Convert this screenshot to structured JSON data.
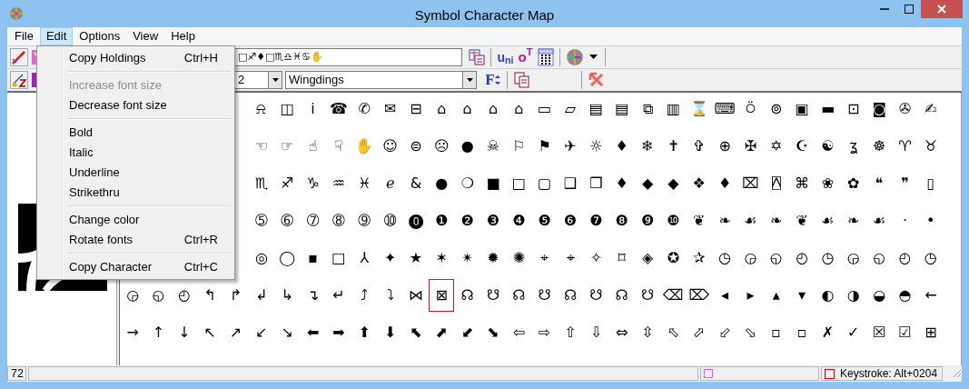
{
  "window": {
    "title": "Symbol Character Map"
  },
  "menu_bar": [
    {
      "label": "File",
      "selected": false
    },
    {
      "label": "Edit",
      "selected": true
    },
    {
      "label": "Options",
      "selected": false
    },
    {
      "label": "View",
      "selected": false
    },
    {
      "label": "Help",
      "selected": false
    }
  ],
  "edit_menu": [
    {
      "kind": "item",
      "label": "Copy Holdings",
      "shortcut": "Ctrl+H",
      "disabled": false
    },
    {
      "kind": "separator"
    },
    {
      "kind": "item",
      "label": "Increase font size",
      "disabled": true
    },
    {
      "kind": "item",
      "label": "Decrease font size",
      "disabled": false
    },
    {
      "kind": "separator"
    },
    {
      "kind": "item",
      "label": "Bold",
      "disabled": false
    },
    {
      "kind": "item",
      "label": "Italic",
      "disabled": false
    },
    {
      "kind": "item",
      "label": "Underline",
      "disabled": false
    },
    {
      "kind": "item",
      "label": "Strikethru",
      "disabled": false
    },
    {
      "kind": "separator"
    },
    {
      "kind": "item",
      "label": "Change color",
      "disabled": false
    },
    {
      "kind": "item",
      "label": "Rotate fonts",
      "shortcut": "Ctrl+R",
      "disabled": false
    },
    {
      "kind": "separator"
    },
    {
      "kind": "item",
      "label": "Copy Character",
      "shortcut": "Ctrl+C",
      "disabled": false
    }
  ],
  "toolbar": {
    "sample_field": {
      "value": "□♐♦□♏♎♓♋✋"
    },
    "uni_button": "u$_{ni}$",
    "opentype_button": "o$^{T}$",
    "size_field": {
      "value": "2"
    },
    "font_field": {
      "value": "Wingdings"
    },
    "font_size_button": "F"
  },
  "grid": {
    "rows": [
      [
        {
          "glyph": "⍾",
          "selected": false
        },
        {
          "glyph": "◫",
          "selected": false
        },
        {
          "glyph": "ⅰ",
          "selected": false
        },
        {
          "glyph": "☎",
          "selected": false
        },
        {
          "glyph": "✆",
          "selected": false
        },
        {
          "glyph": "✉",
          "selected": false
        },
        {
          "glyph": "⊟",
          "selected": false
        },
        {
          "glyph": "⌂",
          "selected": false
        },
        {
          "glyph": "⌂",
          "selected": false
        },
        {
          "glyph": "⌂",
          "selected": false
        },
        {
          "glyph": "⌂",
          "selected": false
        },
        {
          "glyph": "▭",
          "selected": false
        },
        {
          "glyph": "▱",
          "selected": false
        },
        {
          "glyph": "▤",
          "selected": false
        },
        {
          "glyph": "▤",
          "selected": false
        },
        {
          "glyph": "⧉",
          "selected": false
        },
        {
          "glyph": "▥",
          "selected": false
        },
        {
          "glyph": "⌛",
          "selected": false
        },
        {
          "glyph": "⌨",
          "selected": false
        },
        {
          "glyph": "⍥",
          "selected": false
        },
        {
          "glyph": "⊚",
          "selected": false
        },
        {
          "glyph": "▣",
          "selected": false
        },
        {
          "glyph": "▬",
          "selected": false
        },
        {
          "glyph": "⊡",
          "selected": false
        },
        {
          "glyph": "◙",
          "selected": false
        },
        {
          "glyph": "✇",
          "selected": false
        },
        {
          "glyph": "✍",
          "selected": false
        }
      ],
      [
        {
          "glyph": "☜",
          "selected": false
        },
        {
          "glyph": "☞",
          "selected": false
        },
        {
          "glyph": "☝",
          "selected": false
        },
        {
          "glyph": "☟",
          "selected": false
        },
        {
          "glyph": "✋",
          "selected": false
        },
        {
          "glyph": "☺",
          "selected": false
        },
        {
          "glyph": "⊜",
          "selected": false
        },
        {
          "glyph": "☹",
          "selected": false
        },
        {
          "glyph": "●",
          "selected": false
        },
        {
          "glyph": "☠",
          "selected": false
        },
        {
          "glyph": "⚐",
          "selected": false
        },
        {
          "glyph": "⚑",
          "selected": false
        },
        {
          "glyph": "✈",
          "selected": false
        },
        {
          "glyph": "☼",
          "selected": false
        },
        {
          "glyph": "♦",
          "selected": false
        },
        {
          "glyph": "❄",
          "selected": false
        },
        {
          "glyph": "✝",
          "selected": false
        },
        {
          "glyph": "✞",
          "selected": false
        },
        {
          "glyph": "⊕",
          "selected": false
        },
        {
          "glyph": "✠",
          "selected": false
        },
        {
          "glyph": "✡",
          "selected": false
        },
        {
          "glyph": "☪",
          "selected": false
        },
        {
          "glyph": "☯",
          "selected": false
        },
        {
          "glyph": "ʓ",
          "selected": false
        },
        {
          "glyph": "☸",
          "selected": false
        },
        {
          "glyph": "♈",
          "selected": false
        },
        {
          "glyph": "♉",
          "selected": false
        }
      ],
      [
        {
          "glyph": "♏",
          "selected": false
        },
        {
          "glyph": "♐",
          "selected": false
        },
        {
          "glyph": "♑",
          "selected": false
        },
        {
          "glyph": "♒",
          "selected": false
        },
        {
          "glyph": "♓",
          "selected": false
        },
        {
          "glyph": "ℯ",
          "selected": false
        },
        {
          "glyph": "&",
          "selected": false
        },
        {
          "glyph": "●",
          "selected": false
        },
        {
          "glyph": "❍",
          "selected": false
        },
        {
          "glyph": "■",
          "selected": false
        },
        {
          "glyph": "□",
          "selected": false
        },
        {
          "glyph": "▢",
          "selected": false
        },
        {
          "glyph": "❑",
          "selected": false
        },
        {
          "glyph": "❒",
          "selected": false
        },
        {
          "glyph": "♦",
          "selected": false
        },
        {
          "glyph": "◆",
          "selected": false
        },
        {
          "glyph": "◆",
          "selected": false
        },
        {
          "glyph": "❖",
          "selected": false
        },
        {
          "glyph": "♦",
          "selected": false
        },
        {
          "glyph": "⌧",
          "selected": false
        },
        {
          "glyph": "⍓",
          "selected": false
        },
        {
          "glyph": "⌘",
          "selected": false
        },
        {
          "glyph": "❀",
          "selected": false
        },
        {
          "glyph": "✿",
          "selected": false
        },
        {
          "glyph": "❝",
          "selected": false
        },
        {
          "glyph": "❞",
          "selected": false
        },
        {
          "glyph": "▯",
          "selected": false
        }
      ],
      [
        {
          "glyph": "➄",
          "selected": false
        },
        {
          "glyph": "➅",
          "selected": false
        },
        {
          "glyph": "➆",
          "selected": false
        },
        {
          "glyph": "➇",
          "selected": false
        },
        {
          "glyph": "➈",
          "selected": false
        },
        {
          "glyph": "➉",
          "selected": false
        },
        {
          "glyph": "⓿",
          "selected": false
        },
        {
          "glyph": "❶",
          "selected": false
        },
        {
          "glyph": "❷",
          "selected": false
        },
        {
          "glyph": "❸",
          "selected": false
        },
        {
          "glyph": "❹",
          "selected": false
        },
        {
          "glyph": "❺",
          "selected": false
        },
        {
          "glyph": "❻",
          "selected": false
        },
        {
          "glyph": "❼",
          "selected": false
        },
        {
          "glyph": "❽",
          "selected": false
        },
        {
          "glyph": "❾",
          "selected": false
        },
        {
          "glyph": "❿",
          "selected": false
        },
        {
          "glyph": "❦",
          "selected": false
        },
        {
          "glyph": "❧",
          "selected": false
        },
        {
          "glyph": "☙",
          "selected": false
        },
        {
          "glyph": "❧",
          "selected": false
        },
        {
          "glyph": "❦",
          "selected": false
        },
        {
          "glyph": "☙",
          "selected": false
        },
        {
          "glyph": "❧",
          "selected": false
        },
        {
          "glyph": "☙",
          "selected": false
        },
        {
          "glyph": "·",
          "selected": false
        },
        {
          "glyph": "•",
          "selected": false
        }
      ],
      [
        {
          "glyph": "◎",
          "selected": false
        },
        {
          "glyph": "◯",
          "selected": false
        },
        {
          "glyph": "▪",
          "selected": false
        },
        {
          "glyph": "□",
          "selected": false
        },
        {
          "glyph": "⅄",
          "selected": false
        },
        {
          "glyph": "✦",
          "selected": false
        },
        {
          "glyph": "★",
          "selected": false
        },
        {
          "glyph": "✶",
          "selected": false
        },
        {
          "glyph": "✴",
          "selected": false
        },
        {
          "glyph": "✹",
          "selected": false
        },
        {
          "glyph": "✺",
          "selected": false
        },
        {
          "glyph": "⌖",
          "selected": false
        },
        {
          "glyph": "⌖",
          "selected": false
        },
        {
          "glyph": "✧",
          "selected": false
        },
        {
          "glyph": "⌑",
          "selected": false
        },
        {
          "glyph": "◈",
          "selected": false
        },
        {
          "glyph": "✪",
          "selected": false
        },
        {
          "glyph": "✰",
          "selected": false
        },
        {
          "glyph": "◷",
          "selected": false
        },
        {
          "glyph": "◶",
          "selected": false
        },
        {
          "glyph": "◵",
          "selected": false
        },
        {
          "glyph": "◴",
          "selected": false
        },
        {
          "glyph": "◷",
          "selected": false
        },
        {
          "glyph": "◶",
          "selected": false
        },
        {
          "glyph": "◵",
          "selected": false
        },
        {
          "glyph": "◴",
          "selected": false
        },
        {
          "glyph": "◷",
          "selected": false
        }
      ],
      [
        {
          "glyph": "◶",
          "selected": false
        },
        {
          "glyph": "◵",
          "selected": false
        },
        {
          "glyph": "◴",
          "selected": false
        },
        {
          "glyph": "↰",
          "selected": false
        },
        {
          "glyph": "↱",
          "selected": false
        },
        {
          "glyph": "↲",
          "selected": false
        },
        {
          "glyph": "↳",
          "selected": false
        },
        {
          "glyph": "↴",
          "selected": false
        },
        {
          "glyph": "↵",
          "selected": false
        },
        {
          "glyph": "⤴",
          "selected": false
        },
        {
          "glyph": "⤵",
          "selected": false
        },
        {
          "glyph": "⋈",
          "selected": false
        },
        {
          "glyph": "⊠",
          "selected": true
        },
        {
          "glyph": "☊",
          "selected": false
        },
        {
          "glyph": "☋",
          "selected": false
        },
        {
          "glyph": "☊",
          "selected": false
        },
        {
          "glyph": "☋",
          "selected": false
        },
        {
          "glyph": "☊",
          "selected": false
        },
        {
          "glyph": "☋",
          "selected": false
        },
        {
          "glyph": "☊",
          "selected": false
        },
        {
          "glyph": "☋",
          "selected": false
        },
        {
          "glyph": "⌫",
          "selected": false
        },
        {
          "glyph": "⌦",
          "selected": false
        },
        {
          "glyph": "◂",
          "selected": false
        },
        {
          "glyph": "▸",
          "selected": false
        },
        {
          "glyph": "▴",
          "selected": false
        },
        {
          "glyph": "▾",
          "selected": false
        },
        {
          "glyph": "◐",
          "selected": false
        },
        {
          "glyph": "◑",
          "selected": false
        },
        {
          "glyph": "◒",
          "selected": false
        },
        {
          "glyph": "◓",
          "selected": false
        },
        {
          "glyph": "←",
          "selected": false
        }
      ],
      [
        {
          "glyph": "→",
          "selected": false
        },
        {
          "glyph": "↑",
          "selected": false
        },
        {
          "glyph": "↓",
          "selected": false
        },
        {
          "glyph": "↖",
          "selected": false
        },
        {
          "glyph": "↗",
          "selected": false
        },
        {
          "glyph": "↙",
          "selected": false
        },
        {
          "glyph": "↘",
          "selected": false
        },
        {
          "glyph": "⬅",
          "selected": false
        },
        {
          "glyph": "➡",
          "selected": false
        },
        {
          "glyph": "⬆",
          "selected": false
        },
        {
          "glyph": "⬇",
          "selected": false
        },
        {
          "glyph": "⬉",
          "selected": false
        },
        {
          "glyph": "⬈",
          "selected": false
        },
        {
          "glyph": "⬋",
          "selected": false
        },
        {
          "glyph": "⬊",
          "selected": false
        },
        {
          "glyph": "⇦",
          "selected": false
        },
        {
          "glyph": "⇨",
          "selected": false
        },
        {
          "glyph": "⇧",
          "selected": false
        },
        {
          "glyph": "⇩",
          "selected": false
        },
        {
          "glyph": "⇔",
          "selected": false
        },
        {
          "glyph": "⇳",
          "selected": false
        },
        {
          "glyph": "⬁",
          "selected": false
        },
        {
          "glyph": "⬀",
          "selected": false
        },
        {
          "glyph": "⬃",
          "selected": false
        },
        {
          "glyph": "⬂",
          "selected": false
        },
        {
          "glyph": "▫",
          "selected": false
        },
        {
          "glyph": "▫",
          "selected": false
        },
        {
          "glyph": "✗",
          "selected": false
        },
        {
          "glyph": "✓",
          "selected": false
        },
        {
          "glyph": "☒",
          "selected": false
        },
        {
          "glyph": "☑",
          "selected": false
        },
        {
          "glyph": "⊞",
          "selected": false
        }
      ]
    ]
  },
  "status_bar": {
    "size": "72",
    "keystroke": "Keystroke: Alt+0204"
  }
}
